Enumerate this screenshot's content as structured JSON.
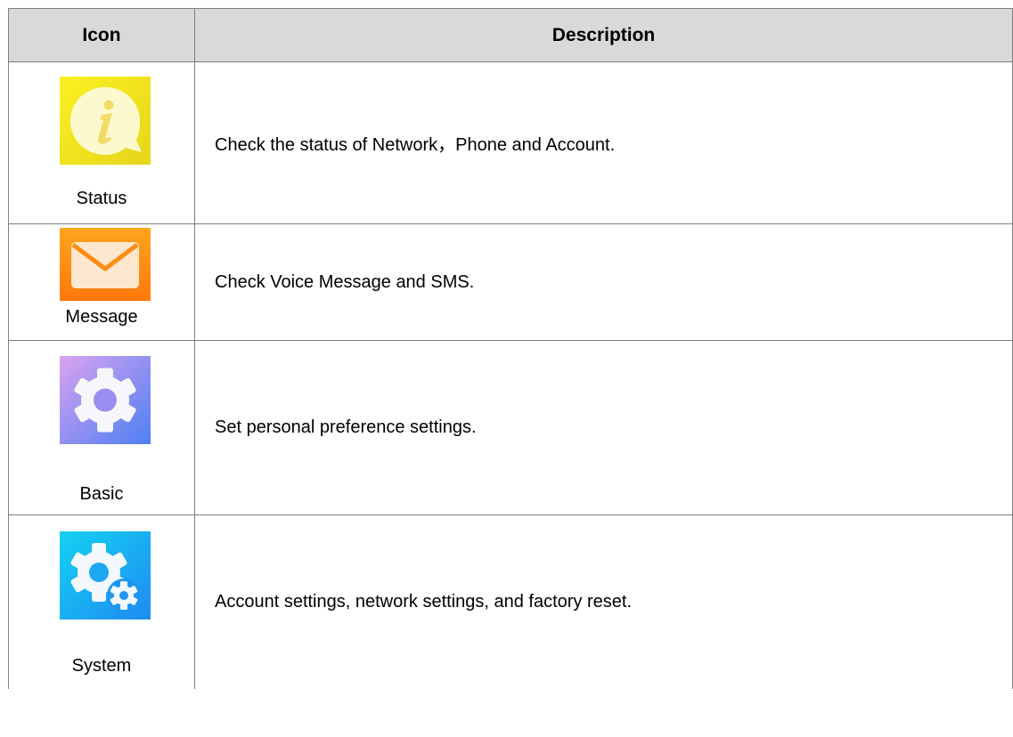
{
  "table": {
    "headers": {
      "icon": "Icon",
      "description": "Description"
    },
    "rows": [
      {
        "icon": "status-info-icon",
        "label": "Status",
        "description": "Check the status of Network，Phone and Account.",
        "colors": [
          "#f8ee1b",
          "#e8d41a"
        ]
      },
      {
        "icon": "message-envelope-icon",
        "label": "Message",
        "description": "Check Voice Message and SMS.",
        "colors": [
          "#ffa31c",
          "#ff7a0a"
        ]
      },
      {
        "icon": "basic-gear-icon",
        "label": "Basic",
        "description": "Set personal preference settings.",
        "colors": [
          "#d49cf0",
          "#4f7ff2"
        ]
      },
      {
        "icon": "system-gears-icon",
        "label": "System",
        "description": "Account settings, network settings, and factory reset.",
        "colors": [
          "#16cdf2",
          "#1e8ef2"
        ]
      }
    ]
  }
}
